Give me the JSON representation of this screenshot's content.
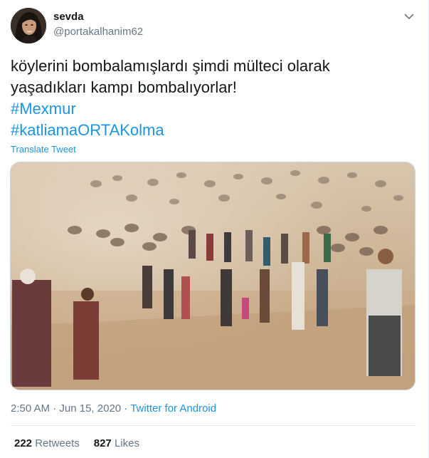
{
  "user": {
    "display_name": "sevda",
    "handle": "@portakalhanim62"
  },
  "tweet": {
    "text_line1": "köylerini bombalamışlardı şimdi mülteci olarak",
    "text_line2": "yaşadıkları kampı bombalıyorlar!",
    "hashtags": [
      "#Mexmur",
      "#katliamaORTAKolma"
    ],
    "translate_label": "Translate Tweet"
  },
  "meta": {
    "time": "2:50 AM",
    "separator": " · ",
    "date": "Jun 15, 2020",
    "source": "Twitter for Android"
  },
  "stats": {
    "retweets_count": "222",
    "retweets_label": "Retweets",
    "likes_count": "827",
    "likes_label": "Likes"
  },
  "colors": {
    "link": "#1b95e0",
    "secondary_text": "#657786",
    "primary_text": "#14171a"
  },
  "icons": {
    "caret": "chevron-down-icon"
  }
}
